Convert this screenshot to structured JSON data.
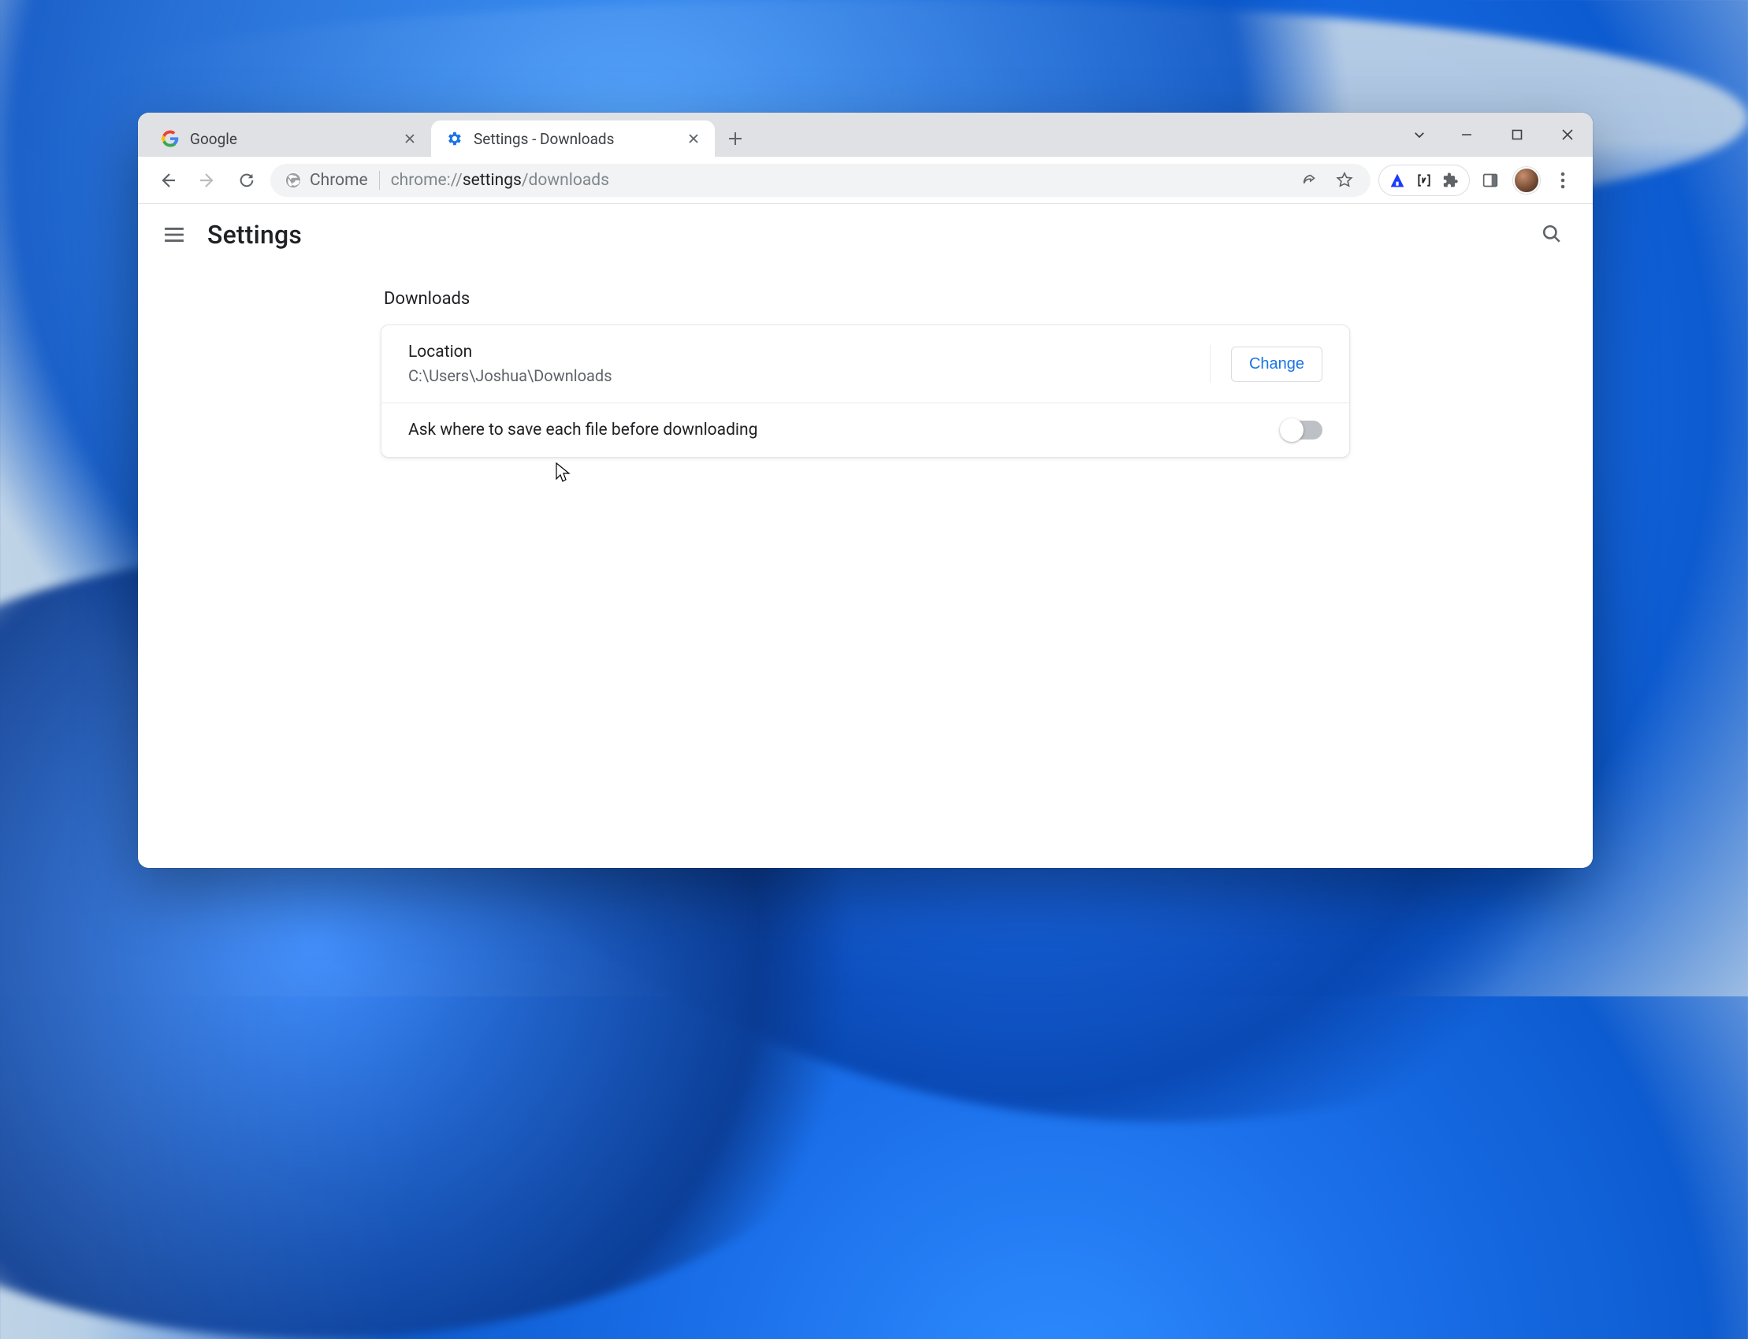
{
  "tabs": [
    {
      "title": "Google",
      "active": false
    },
    {
      "title": "Settings - Downloads",
      "active": true
    }
  ],
  "omnibox": {
    "scheme_label": "Chrome",
    "url_prefix": "chrome://",
    "url_strong": "settings",
    "url_suffix": "/downloads"
  },
  "settings": {
    "header_title": "Settings",
    "section_title": "Downloads",
    "location_label": "Location",
    "location_value": "C:\\Users\\Joshua\\Downloads",
    "change_button": "Change",
    "ask_label": "Ask where to save each file before downloading",
    "ask_enabled": false
  }
}
